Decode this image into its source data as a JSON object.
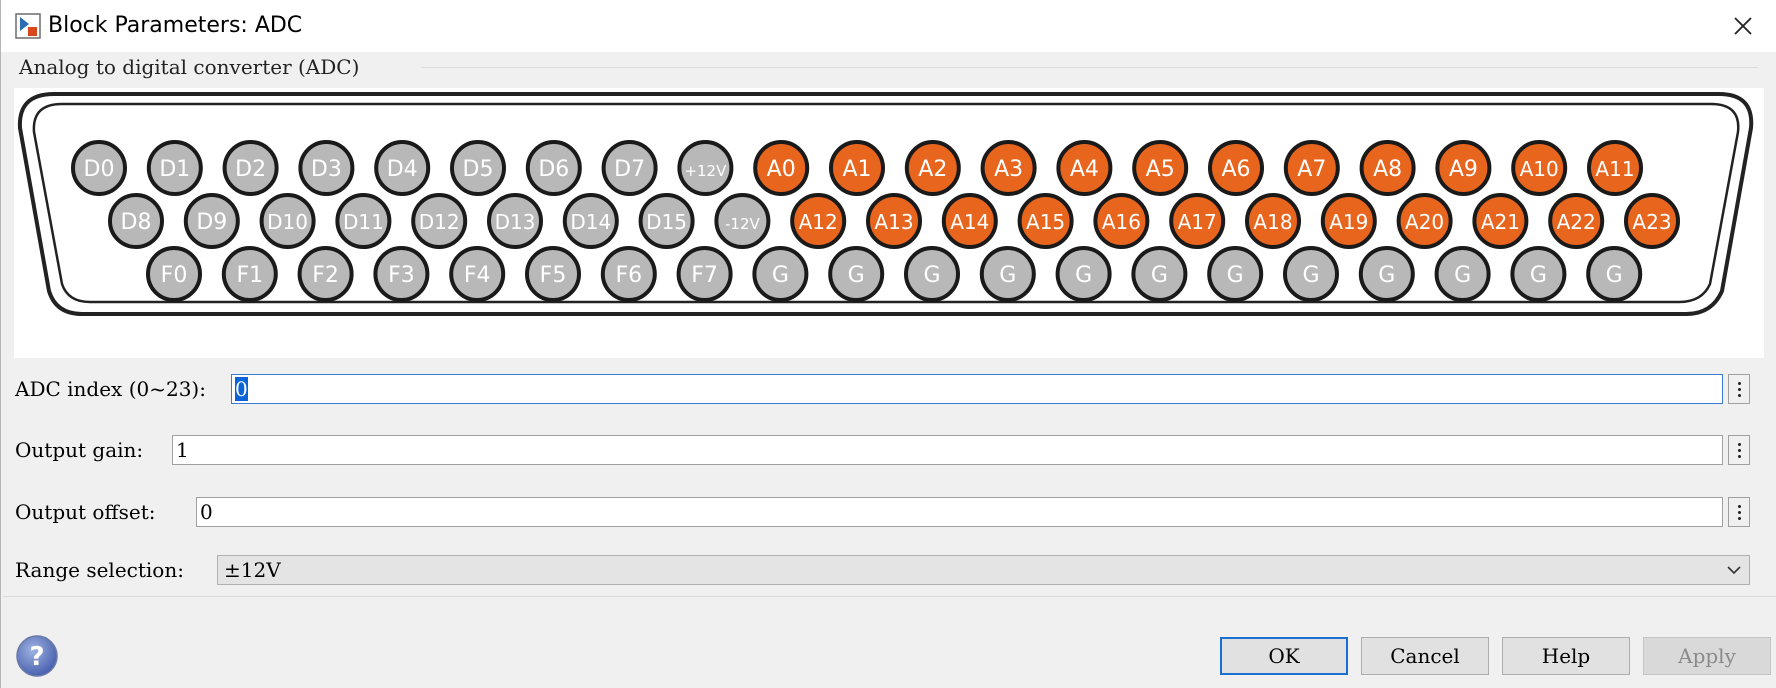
{
  "window": {
    "title": "Block Parameters: ADC"
  },
  "group": {
    "title": "Analog to digital converter (ADC)"
  },
  "connector": {
    "row1": [
      "D0",
      "D1",
      "D2",
      "D3",
      "D4",
      "D5",
      "D6",
      "D7",
      "+12V",
      "A0",
      "A1",
      "A2",
      "A3",
      "A4",
      "A5",
      "A6",
      "A7",
      "A8",
      "A9",
      "A10",
      "A11"
    ],
    "row2": [
      "D8",
      "D9",
      "D10",
      "D11",
      "D12",
      "D13",
      "D14",
      "D15",
      "-12V",
      "A12",
      "A13",
      "A14",
      "A15",
      "A16",
      "A17",
      "A18",
      "A19",
      "A20",
      "A21",
      "A22",
      "A23"
    ],
    "row3": [
      "F0",
      "F1",
      "F2",
      "F3",
      "F4",
      "F5",
      "F6",
      "F7",
      "G",
      "G",
      "G",
      "G",
      "G",
      "G",
      "G",
      "G",
      "G",
      "G",
      "G",
      "G"
    ],
    "colors": {
      "analog_pin": "#e8651e",
      "other_pin": "#b8b8b8",
      "pin_border": "#1a1a1a"
    }
  },
  "params": {
    "adc_index": {
      "label": "ADC index (0~23):",
      "value": "0"
    },
    "output_gain": {
      "label": "Output gain:",
      "value": "1"
    },
    "output_offset": {
      "label": "Output offset:",
      "value": "0"
    },
    "range_selection": {
      "label": "Range selection:",
      "value": "±12V"
    }
  },
  "buttons": {
    "ok": "OK",
    "cancel": "Cancel",
    "help": "Help",
    "apply": "Apply"
  },
  "icons": {
    "app": "simulink-block-icon",
    "close": "close-icon",
    "help": "question-mark-icon",
    "more": "kebab-menu-icon",
    "dropdown": "chevron-down-icon"
  },
  "colors": {
    "focus": "#3a7bd5",
    "selection": "#0a64d8",
    "default_button_border": "#1a6fd1"
  }
}
